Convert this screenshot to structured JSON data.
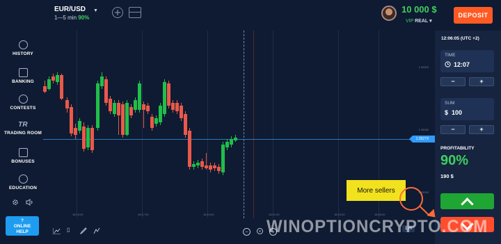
{
  "header": {
    "asset": "EUR/USD",
    "timeframe": "1—5 min",
    "payout_pct": "90%",
    "balance": "10 000 $",
    "account_tier": "VIP",
    "account_type": "REAL",
    "deposit_label": "DEPOSIT"
  },
  "sidebar": {
    "items": [
      {
        "label": "HISTORY",
        "icon": "history-icon"
      },
      {
        "label": "BANKING",
        "icon": "wallet-icon"
      },
      {
        "label": "CONTESTS",
        "icon": "trophy-icon"
      },
      {
        "label": "TRADING ROOM",
        "icon": "tr-logo-icon",
        "glyph": "TR"
      },
      {
        "label": "BONUSES",
        "icon": "gift-icon"
      },
      {
        "label": "EDUCATION",
        "icon": "graduation-cap-icon"
      }
    ],
    "help_line1": "?",
    "help_line2": "ONLINE",
    "help_line3": "HELP"
  },
  "chart": {
    "current_price": "1.0527X",
    "y_labels": [
      "1.05300",
      "1.05280",
      "1.05260"
    ],
    "x_labels": [
      "18:15:00",
      "18:17:00",
      "18:19:00",
      "18:21:00",
      "18:23:00",
      "18:25:00"
    ],
    "timeframe_button": "1 m",
    "colors": {
      "up": "#1fbf4a",
      "down": "#e9594b",
      "price_line": "#2a7ac0"
    }
  },
  "panel": {
    "clock": "12:06:05 (UTC +2)",
    "time_label": "TIME",
    "time_value": "12:07",
    "sum_label": "SUM",
    "sum_currency": "$",
    "sum_value": "100",
    "minus": "−",
    "plus": "+",
    "profitability_label": "PROFITABILITY",
    "profitability_value": "90%",
    "payout_value": "190 $"
  },
  "callout": {
    "text": "More sellers"
  },
  "watermark": "WINOPTIONCRYPTO.COM"
}
